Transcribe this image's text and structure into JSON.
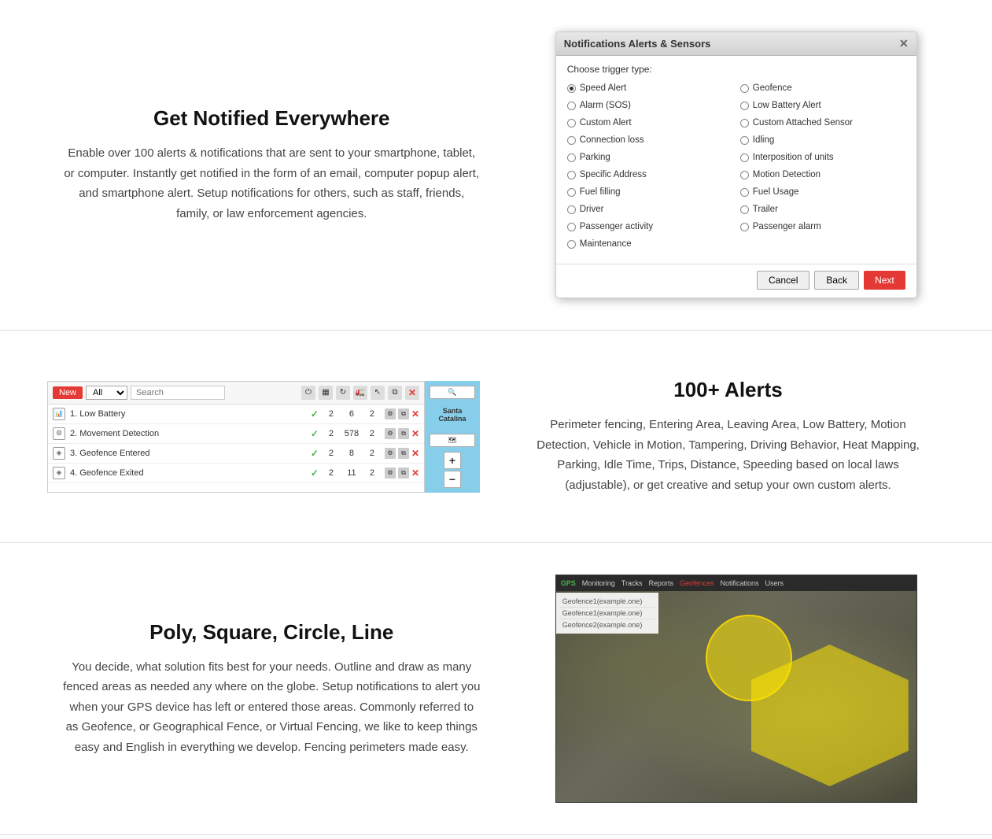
{
  "section1": {
    "title": "Get Notified Everywhere",
    "description": "Enable over 100 alerts & notifications that are sent to your smartphone, tablet, or computer. Instantly get notified in the form of an email, computer popup alert, and smartphone alert. Setup notifications for others, such as staff, friends, family, or law enforcement agencies."
  },
  "section2": {
    "title": "100+ Alerts",
    "description": "Perimeter fencing, Entering Area, Leaving Area, Low Battery, Motion Detection, Vehicle in Motion, Tampering, Driving Behavior, Heat Mapping, Parking, Idle Time, Trips, Distance, Speeding based on local laws (adjustable), or get creative and setup your own custom alerts."
  },
  "section3": {
    "title": "Poly, Square, Circle, Line",
    "description": "You decide, what solution fits best for your needs. Outline and draw as many fenced areas as needed any where on the globe. Setup notifications to alert you when your GPS device has left or entered those areas. Commonly referred to as Geofence, or Geographical Fence, or Virtual Fencing, we like to keep things easy and English in everything we develop. Fencing perimeters made easy."
  },
  "dialog": {
    "title": "Notifications Alerts & Sensors",
    "trigger_label": "Choose trigger type:",
    "options_left": [
      {
        "label": "Speed Alert",
        "selected": true
      },
      {
        "label": "Alarm (SOS)",
        "selected": false
      },
      {
        "label": "Custom Alert",
        "selected": false
      },
      {
        "label": "Connection loss",
        "selected": false
      },
      {
        "label": "Parking",
        "selected": false
      },
      {
        "label": "Specific Address",
        "selected": false
      },
      {
        "label": "Fuel filling",
        "selected": false
      },
      {
        "label": "Driver",
        "selected": false
      },
      {
        "label": "Passenger activity",
        "selected": false
      },
      {
        "label": "Maintenance",
        "selected": false
      }
    ],
    "options_right": [
      {
        "label": "Geofence",
        "selected": false
      },
      {
        "label": "Low Battery Alert",
        "selected": false
      },
      {
        "label": "Custom Attached Sensor",
        "selected": false
      },
      {
        "label": "Idling",
        "selected": false
      },
      {
        "label": "Interposition of units",
        "selected": false
      },
      {
        "label": "Motion Detection",
        "selected": false
      },
      {
        "label": "Fuel Usage",
        "selected": false
      },
      {
        "label": "Trailer",
        "selected": false
      },
      {
        "label": "Passenger alarm",
        "selected": false
      }
    ],
    "btn_cancel": "Cancel",
    "btn_back": "Back",
    "btn_next": "Next"
  },
  "alerts_panel": {
    "btn_new": "New",
    "select_placeholder": "All",
    "search_placeholder": "Search",
    "rows": [
      {
        "id": 1,
        "name": "1. Low Battery",
        "checked": true,
        "num1": 2,
        "num2": 6,
        "num3": 2
      },
      {
        "id": 2,
        "name": "2. Movement Detection",
        "checked": true,
        "num1": 2,
        "num2": 578,
        "num3": 2
      },
      {
        "id": 3,
        "name": "3. Geofence Entered",
        "checked": true,
        "num1": 2,
        "num2": 8,
        "num3": 2
      },
      {
        "id": 4,
        "name": "4. Geofence Exited",
        "checked": true,
        "num1": 2,
        "num2": 11,
        "num3": 2
      }
    ],
    "map_location": "Santa Catalina",
    "zoom_plus": "+",
    "zoom_minus": "−"
  },
  "geo_topbar": {
    "items": [
      "Monitoring",
      "Tracks",
      "Reports",
      "Geofences",
      "Notifications",
      "Users"
    ]
  },
  "icons": {
    "close": "✕",
    "search": "🔍",
    "check": "✓",
    "x": "✕",
    "zoom_plus": "+",
    "zoom_minus": "−",
    "refresh": "↻",
    "copy": "⧉",
    "settings": "⚙"
  }
}
